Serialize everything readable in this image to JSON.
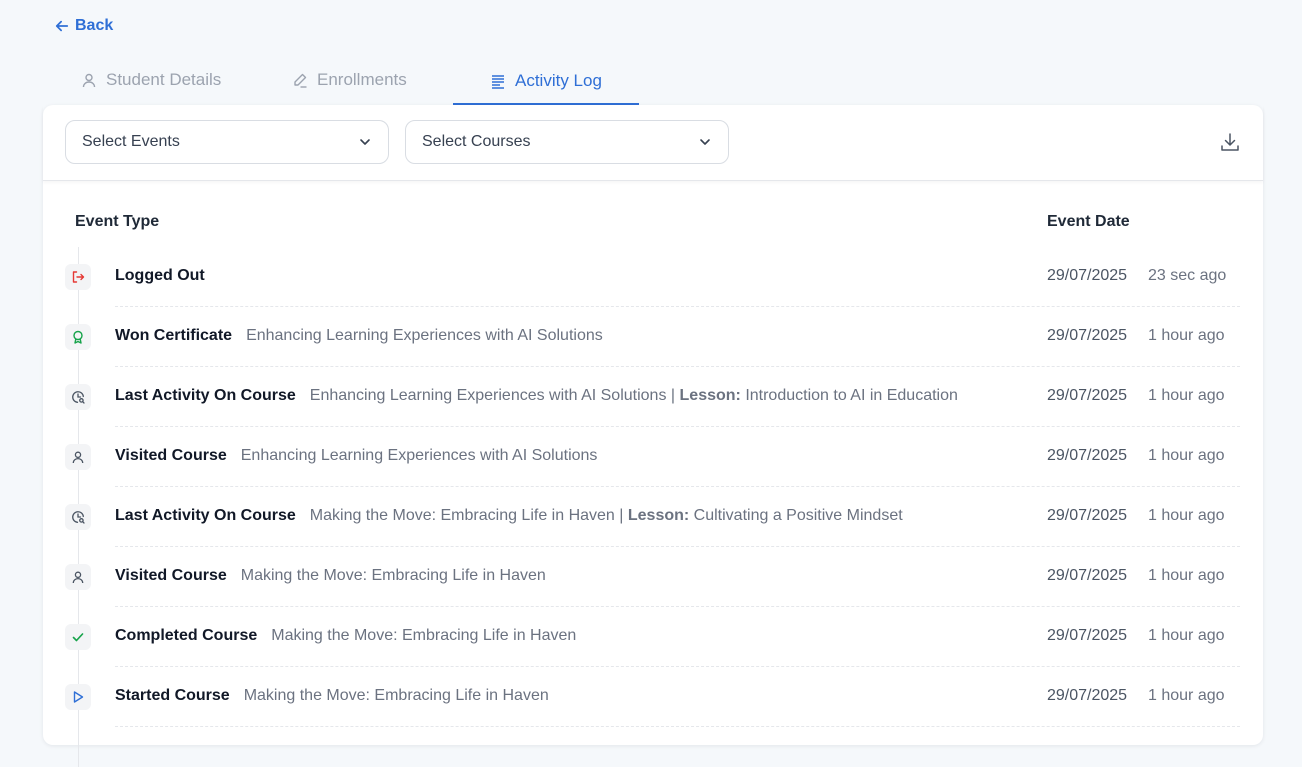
{
  "nav": {
    "back_label": "Back"
  },
  "tabs": [
    {
      "label": "Student Details",
      "icon": "user-icon",
      "active": false
    },
    {
      "label": "Enrollments",
      "icon": "pencil-icon",
      "active": false
    },
    {
      "label": "Activity Log",
      "icon": "list-icon",
      "active": true
    }
  ],
  "filters": {
    "events_placeholder": "Select Events",
    "courses_placeholder": "Select Courses",
    "download_icon": "download-icon"
  },
  "table": {
    "col_event_type": "Event Type",
    "col_event_date": "Event Date",
    "rows": [
      {
        "event": "Logged Out",
        "desc": "",
        "lesson_label": "",
        "lesson": "",
        "date": "29/07/2025",
        "ago": "23 sec ago",
        "icon": "logout-icon",
        "icon_color": "#e53935"
      },
      {
        "event": "Won Certificate",
        "desc": "Enhancing Learning Experiences with AI Solutions",
        "lesson_label": "",
        "lesson": "",
        "date": "29/07/2025",
        "ago": "1 hour ago",
        "icon": "award-icon",
        "icon_color": "#16a34a"
      },
      {
        "event": "Last Activity On Course",
        "desc": "Enhancing Learning Experiences with AI Solutions |",
        "lesson_label": "Lesson:",
        "lesson": "Introduction to AI in Education",
        "date": "29/07/2025",
        "ago": "1 hour ago",
        "icon": "clock-search-icon",
        "icon_color": "#4b5563"
      },
      {
        "event": "Visited Course",
        "desc": "Enhancing Learning Experiences with AI Solutions",
        "lesson_label": "",
        "lesson": "",
        "date": "29/07/2025",
        "ago": "1 hour ago",
        "icon": "user-icon",
        "icon_color": "#4b5563"
      },
      {
        "event": "Last Activity On Course",
        "desc": "Making the Move: Embracing Life in Haven |",
        "lesson_label": "Lesson:",
        "lesson": "Cultivating a Positive Mindset",
        "date": "29/07/2025",
        "ago": "1 hour ago",
        "icon": "clock-search-icon",
        "icon_color": "#4b5563"
      },
      {
        "event": "Visited Course",
        "desc": "Making the Move: Embracing Life in Haven",
        "lesson_label": "",
        "lesson": "",
        "date": "29/07/2025",
        "ago": "1 hour ago",
        "icon": "user-icon",
        "icon_color": "#4b5563"
      },
      {
        "event": "Completed Course",
        "desc": "Making the Move: Embracing Life in Haven",
        "lesson_label": "",
        "lesson": "",
        "date": "29/07/2025",
        "ago": "1 hour ago",
        "icon": "check-icon",
        "icon_color": "#16a34a"
      },
      {
        "event": "Started Course",
        "desc": "Making the Move: Embracing Life in Haven",
        "lesson_label": "",
        "lesson": "",
        "date": "29/07/2025",
        "ago": "1 hour ago",
        "icon": "play-icon",
        "icon_color": "#2f6fd6"
      }
    ]
  },
  "colors": {
    "accent": "#2f6fd6",
    "muted": "#9ca3af",
    "background": "#f5f8fb"
  }
}
